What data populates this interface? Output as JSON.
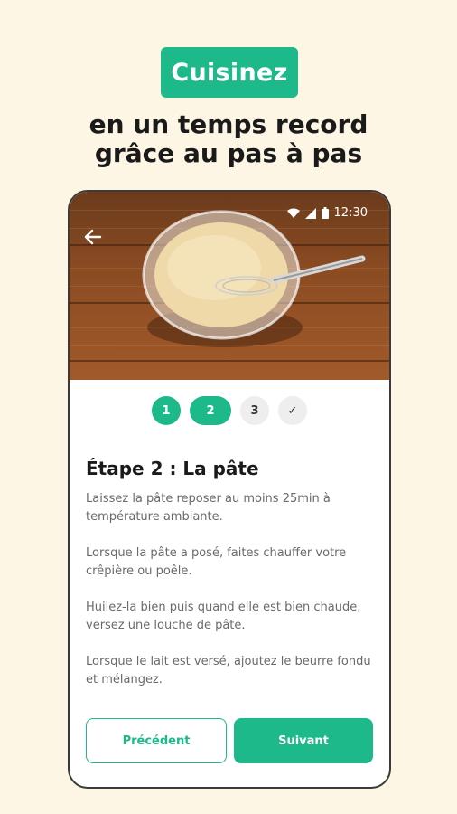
{
  "promo": {
    "badge": "Cuisinez",
    "headline_line1": "en un temps record",
    "headline_line2": "grâce au pas à pas"
  },
  "status_bar": {
    "time": "12:30",
    "icons": [
      "wifi-icon",
      "signal-icon",
      "battery-icon"
    ]
  },
  "header": {
    "back_icon": "arrow-left-icon"
  },
  "stepper": {
    "steps": [
      {
        "label": "1",
        "state": "done"
      },
      {
        "label": "2",
        "state": "active"
      },
      {
        "label": "3",
        "state": "todo"
      },
      {
        "label": "✓",
        "state": "todo"
      }
    ]
  },
  "recipe": {
    "step_title": "Étape 2 : La pâte",
    "paragraphs": [
      "Laissez la pâte reposer au moins 25min à température ambiante.",
      "Lorsque la pâte a posé, faites chauffer votre crêpière ou poêle.",
      "Huilez-la bien puis quand elle est bien chaude, versez une louche de pâte.",
      "Lorsque le lait est versé, ajoutez le beurre fondu et mélangez."
    ]
  },
  "actions": {
    "prev_label": "Précédent",
    "next_label": "Suivant"
  },
  "colors": {
    "accent": "#1db98a",
    "background": "#fdf6e4",
    "text": "#1a1a1a"
  }
}
